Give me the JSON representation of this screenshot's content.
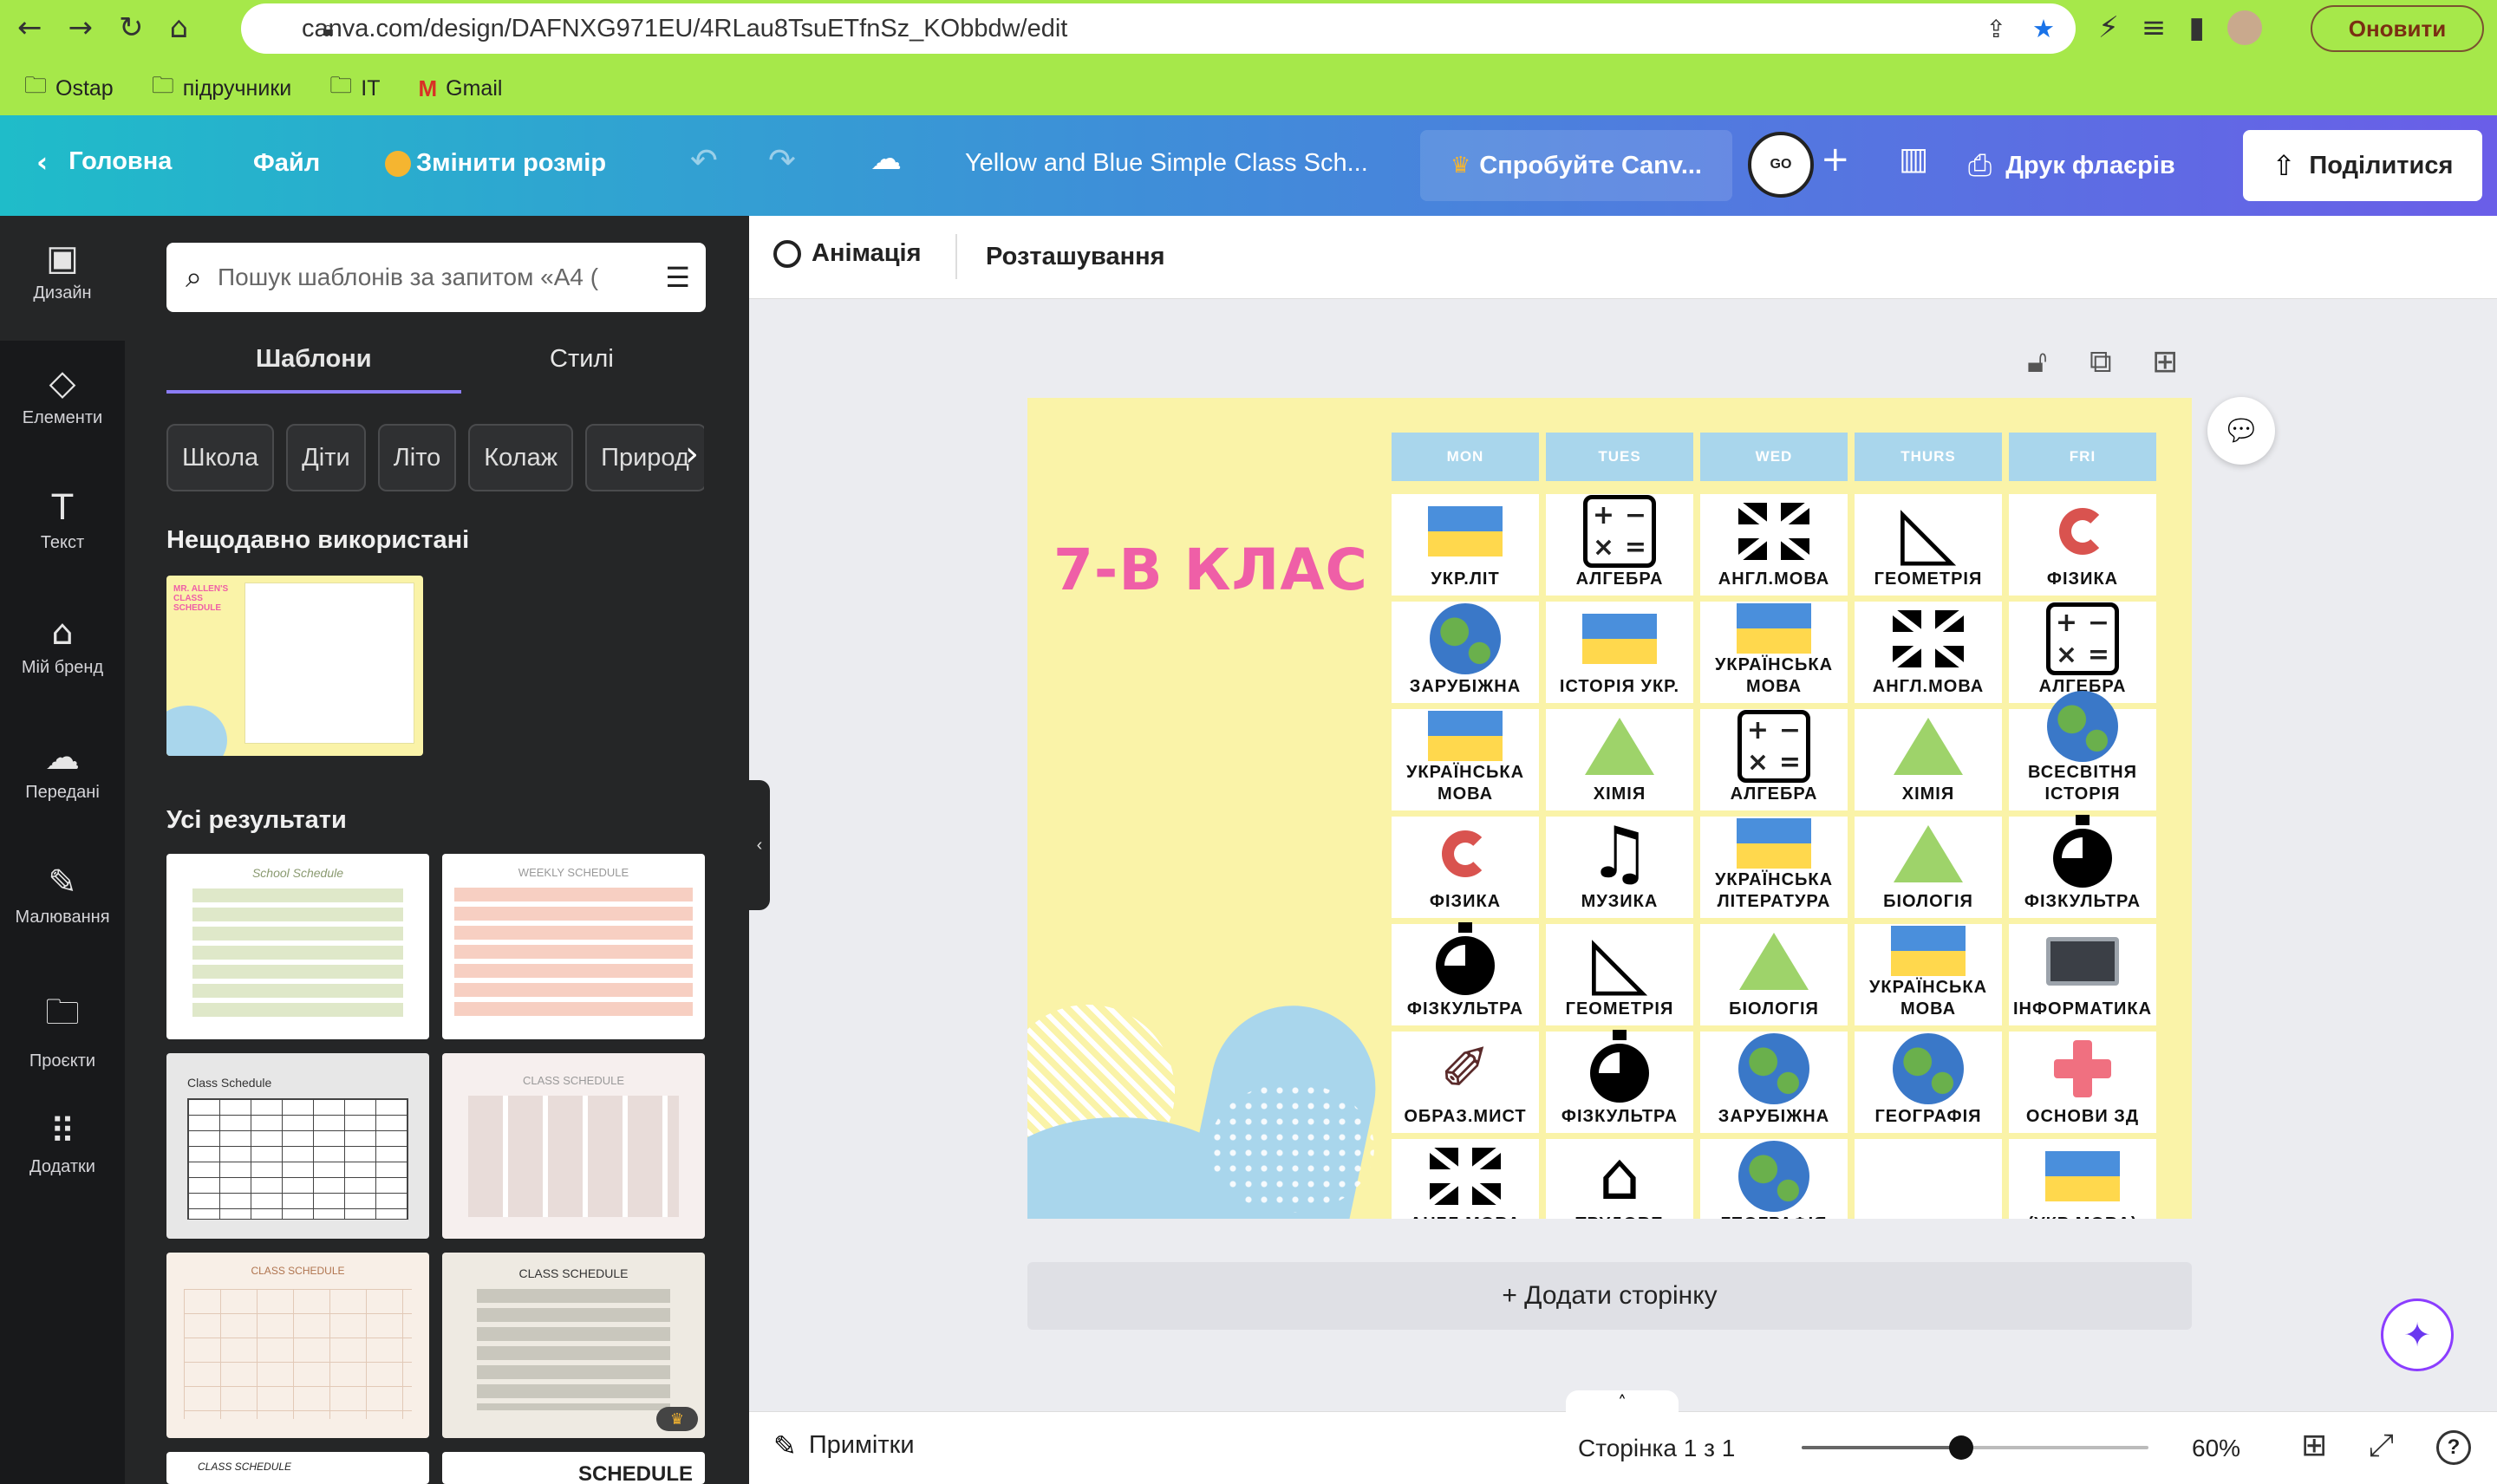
{
  "browser": {
    "url": "canva.com/design/DAFNXG971EU/4RLau8TsuETfnSz_KObbdw/edit",
    "update_label": "Оновити",
    "bookmarks": [
      "Ostap",
      "підручники",
      "IT",
      "Gmail"
    ]
  },
  "topbar": {
    "home": "Головна",
    "file": "Файл",
    "resize": "Змінити розмір",
    "doc_title": "Yellow and Blue Simple Class Sch...",
    "try_pro": "Спробуйте Canv...",
    "print": "Друк флаєрів",
    "share": "Поділитися"
  },
  "rail": [
    {
      "label": "Дизайн",
      "icon": "design-icon"
    },
    {
      "label": "Елементи",
      "icon": "elements-icon"
    },
    {
      "label": "Текст",
      "icon": "text-icon"
    },
    {
      "label": "Мій бренд",
      "icon": "brand-icon"
    },
    {
      "label": "Передані",
      "icon": "uploads-icon"
    },
    {
      "label": "Малювання",
      "icon": "draw-icon"
    },
    {
      "label": "Проєкти",
      "icon": "folder-icon"
    },
    {
      "label": "Додатки",
      "icon": "apps-icon"
    }
  ],
  "panel": {
    "search_placeholder": "Пошук шаблонів за запитом «A4 (",
    "tabs": [
      "Шаблони",
      "Стилі"
    ],
    "chips": [
      "Школа",
      "Діти",
      "Літо",
      "Колаж",
      "Природ"
    ],
    "recent_title": "Нещодавно використані",
    "all_title": "Усі результати",
    "thumb_texts": [
      "MR. ALLEN'S CLASS SCHEDULE",
      "School Schedule",
      "WEEKLY SCHEDULE",
      "Class Schedule",
      "CLASS SCHEDULE",
      "CLASS SCHEDULE",
      "CLASS SCHEDULE",
      "CLASS SCHEDULE",
      "SCHEDULE"
    ]
  },
  "context": {
    "animation": "Анімація",
    "position": "Розташування"
  },
  "schedule": {
    "title": "7-В КЛАС",
    "days": [
      "MON",
      "TUES",
      "WED",
      "THURS",
      "FRI"
    ],
    "rows": [
      [
        {
          "t": "УКР.ЛІТ",
          "i": "flag"
        },
        {
          "t": "АЛГЕБРА",
          "i": "calc"
        },
        {
          "t": "АНГЛ.МОВА",
          "i": "uk"
        },
        {
          "t": "ГЕОМЕТРІЯ",
          "i": "ruler"
        },
        {
          "t": "ФІЗИКА",
          "i": "magnet"
        }
      ],
      [
        {
          "t": "ЗАРУБІЖНА",
          "i": "earth"
        },
        {
          "t": "ІСТОРІЯ УКР.",
          "i": "flag"
        },
        {
          "t": "УКРАЇНСЬКА МОВА",
          "i": "flag"
        },
        {
          "t": "АНГЛ.МОВА",
          "i": "uk"
        },
        {
          "t": "АЛГЕБРА",
          "i": "calc"
        }
      ],
      [
        {
          "t": "УКРАЇНСЬКА МОВА",
          "i": "flag"
        },
        {
          "t": "ХІМІЯ",
          "i": "flask"
        },
        {
          "t": "АЛГЕБРА",
          "i": "calc"
        },
        {
          "t": "ХІМІЯ",
          "i": "flask"
        },
        {
          "t": "ВСЕСВІТНЯ ІСТОРІЯ",
          "i": "earth"
        }
      ],
      [
        {
          "t": "ФІЗИКА",
          "i": "magnet"
        },
        {
          "t": "МУЗИКА",
          "i": "music"
        },
        {
          "t": "УКРАЇНСЬКА ЛІТЕРАТУРА",
          "i": "flag"
        },
        {
          "t": "БІОЛОГІЯ",
          "i": "flask"
        },
        {
          "t": "ФІЗКУЛЬТРА",
          "i": "timer"
        }
      ],
      [
        {
          "t": "ФІЗКУЛЬТРА",
          "i": "timer"
        },
        {
          "t": "ГЕОМЕТРІЯ",
          "i": "ruler"
        },
        {
          "t": "БІОЛОГІЯ",
          "i": "flask"
        },
        {
          "t": "УКРАЇНСЬКА МОВА",
          "i": "flag"
        },
        {
          "t": "ІНФОРМАТИКА",
          "i": "monitor"
        }
      ],
      [
        {
          "t": "ОБРАЗ.МИСТ",
          "i": "brush"
        },
        {
          "t": "ФІЗКУЛЬТРА",
          "i": "timer"
        },
        {
          "t": "ЗАРУБІЖНА",
          "i": "earth"
        },
        {
          "t": "ГЕОГРАФІЯ",
          "i": "earth"
        },
        {
          "t": "ОСНОВИ ЗД",
          "i": "cross"
        }
      ],
      [
        {
          "t": "АНГЛ.МОВА",
          "i": "uk"
        },
        {
          "t": "ТРУДОВЕ",
          "i": "house"
        },
        {
          "t": "ГЕОГРАФІЯ",
          "i": "earth"
        },
        {
          "t": "",
          "i": "none"
        },
        {
          "t": "(УКР МОВА)",
          "i": "flag"
        }
      ]
    ]
  },
  "editor": {
    "add_page": "+ Додати сторінку"
  },
  "bottom": {
    "notes": "Примітки",
    "page_indicator": "Сторінка 1 з 1",
    "zoom": "60%",
    "zoom_level": 0.46
  },
  "colors": {
    "accent": "#8b3dff",
    "page_bg": "#faf3a8",
    "day_header": "#a9d6ec",
    "title_pink": "#ef5fa7"
  }
}
